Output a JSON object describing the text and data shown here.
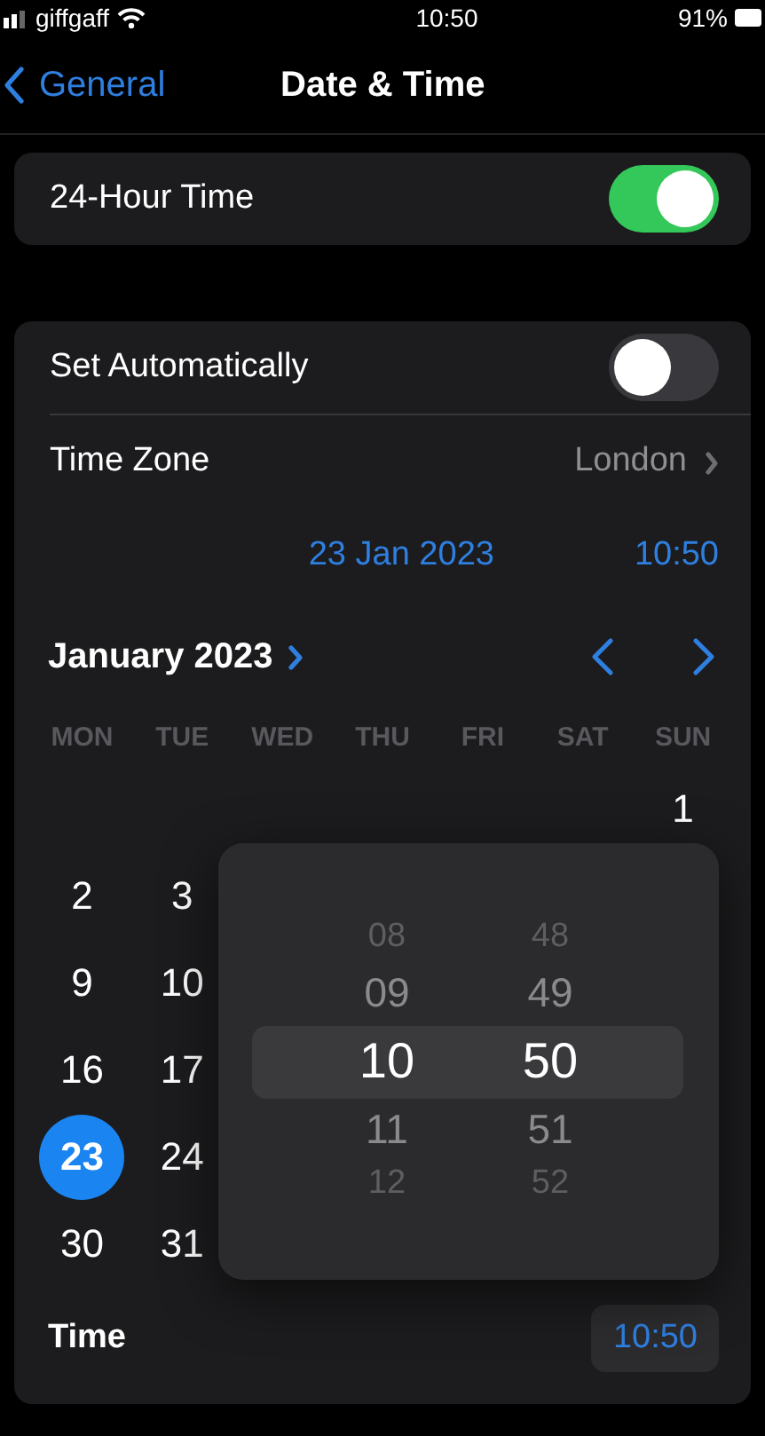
{
  "status_bar": {
    "carrier": "giffgaff",
    "time": "10:50",
    "battery": "91%"
  },
  "nav": {
    "back_label": "General",
    "title": "Date & Time"
  },
  "hour24": {
    "label": "24-Hour Time",
    "on": true
  },
  "auto": {
    "label": "Set Automatically",
    "on": false
  },
  "time_zone": {
    "label": "Time Zone",
    "value": "London"
  },
  "current": {
    "date": "23 Jan 2023",
    "time": "10:50"
  },
  "calendar": {
    "month_label": "January 2023",
    "weekdays": [
      "MON",
      "TUE",
      "WED",
      "THU",
      "FRI",
      "SAT",
      "SUN"
    ],
    "weeks": [
      {
        "kind": "end",
        "days": [
          {
            "day": "1",
            "selected": false
          }
        ]
      },
      {
        "kind": "start",
        "days": [
          {
            "day": "2",
            "selected": false
          },
          {
            "day": "3",
            "selected": false
          }
        ]
      },
      {
        "kind": "start",
        "days": [
          {
            "day": "9",
            "selected": false
          },
          {
            "day": "10",
            "selected": false
          }
        ]
      },
      {
        "kind": "start",
        "days": [
          {
            "day": "16",
            "selected": false
          },
          {
            "day": "17",
            "selected": false
          }
        ]
      },
      {
        "kind": "start",
        "days": [
          {
            "day": "23",
            "selected": true
          },
          {
            "day": "24",
            "selected": false
          }
        ]
      },
      {
        "kind": "start",
        "days": [
          {
            "day": "30",
            "selected": false
          },
          {
            "day": "31",
            "selected": false
          }
        ]
      }
    ]
  },
  "picker": {
    "hours": [
      {
        "value": "08",
        "selected": false
      },
      {
        "value": "09",
        "selected": false
      },
      {
        "value": "10",
        "selected": true
      },
      {
        "value": "11",
        "selected": false
      },
      {
        "value": "12",
        "selected": false
      }
    ],
    "minutes": [
      {
        "value": "48",
        "selected": false
      },
      {
        "value": "49",
        "selected": false
      },
      {
        "value": "50",
        "selected": true
      },
      {
        "value": "51",
        "selected": false
      },
      {
        "value": "52",
        "selected": false
      }
    ]
  },
  "time_row": {
    "label": "Time",
    "value": "10:50"
  }
}
